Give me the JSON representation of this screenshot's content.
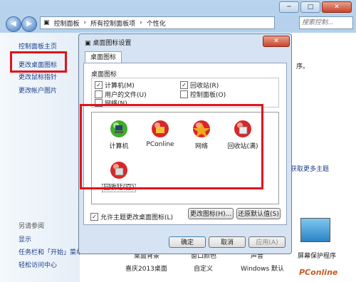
{
  "window": {
    "breadcrumb": [
      "控制面板",
      "所有控制面板项",
      "个性化"
    ],
    "search_placeholder": "搜索控制...",
    "controls": [
      "─",
      "□",
      "✕"
    ]
  },
  "left_pane": {
    "links": [
      "控制面板主页",
      "更改桌面图标",
      "更改鼠标指针",
      "更改帐户图片"
    ],
    "see_also_title": "另请参阅",
    "see_also": [
      "显示",
      "任务栏和「开始」菜单",
      "轻松访问中心"
    ]
  },
  "background": {
    "fragment_right": "序。",
    "online_link": "获取更多主题",
    "theme_labels": [
      "喜庆2013桌面",
      "自定义",
      "Windows 默认"
    ],
    "theme_labels_top": [
      "桌面背景",
      "窗口颜色",
      "声音",
      "屏幕保护程序"
    ],
    "watermark": "PConline"
  },
  "dialog": {
    "title": "桌面图标设置",
    "close": "✕",
    "tab": "桌面图标",
    "group_label": "桌面图标",
    "checkboxes": [
      {
        "label": "计算机(M)",
        "checked": true
      },
      {
        "label": "回收站(R)",
        "checked": true
      },
      {
        "label": "用户的文件(U)",
        "checked": false
      },
      {
        "label": "控制面板(O)",
        "checked": false
      },
      {
        "label": "网络(N)",
        "checked": false
      }
    ],
    "icons": [
      {
        "label": "计算机",
        "icon": "computer-icon"
      },
      {
        "label": "PConline",
        "icon": "user-folder-icon"
      },
      {
        "label": "网络",
        "icon": "network-icon"
      },
      {
        "label": "回收站(满)",
        "icon": "recycle-bin-full-icon"
      },
      {
        "label": "回收站(空)",
        "icon": "recycle-bin-empty-icon"
      }
    ],
    "change_icon_btn": "更改图标(H)...",
    "restore_default_btn": "还原默认值(S)",
    "allow_themes": {
      "label": "允许主题更改桌面图标(L)",
      "checked": true
    },
    "ok": "确定",
    "cancel": "取消",
    "apply": "应用(A)"
  },
  "colors": {
    "highlight": "#e0141b",
    "link": "#1a3e8c"
  }
}
